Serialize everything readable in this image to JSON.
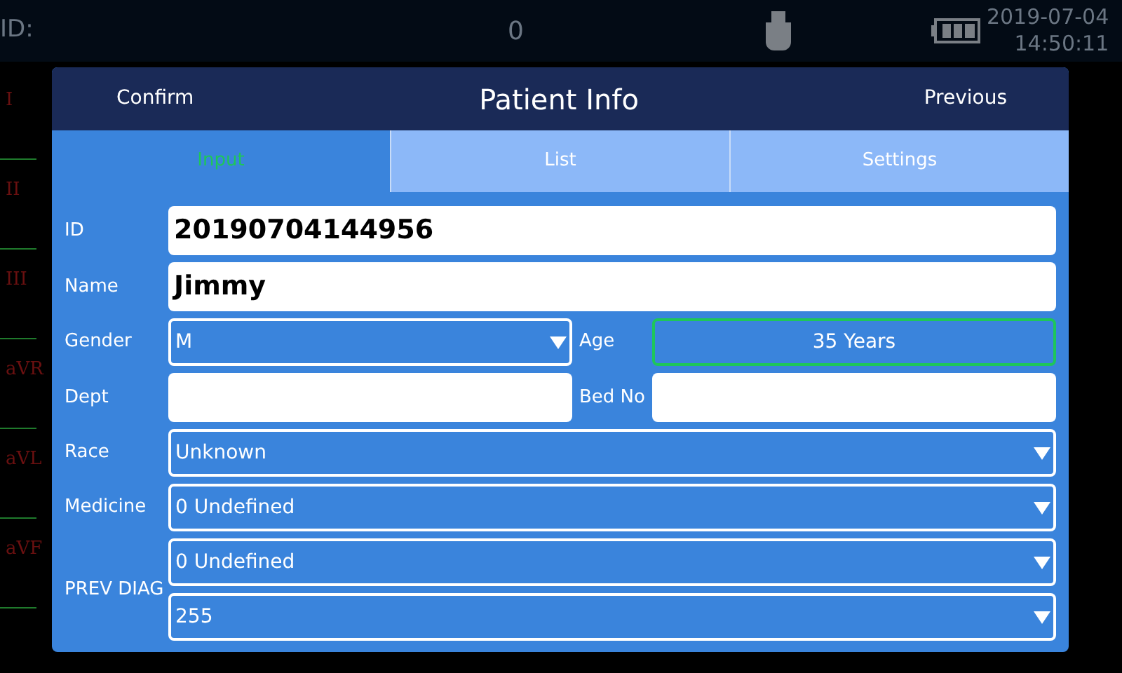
{
  "status_bar": {
    "id_label": "ID:",
    "value": "0",
    "date": "2019-07-04",
    "time": "14:50:11"
  },
  "leads": [
    "I",
    "II",
    "III",
    "aVR",
    "aVL",
    "aVF"
  ],
  "dialog": {
    "title": "Patient Info",
    "confirm": "Confirm",
    "previous": "Previous",
    "tabs": [
      {
        "label": "Input",
        "selected": true
      },
      {
        "label": "List",
        "selected": false
      },
      {
        "label": "Settings",
        "selected": false
      }
    ],
    "rows": [
      {
        "label": "ID",
        "fields": [
          {
            "kind": "text",
            "value": "20190704144956",
            "bold": true
          }
        ]
      },
      {
        "label": "Name",
        "fields": [
          {
            "kind": "text",
            "value": "Jimmy",
            "bold": true
          }
        ]
      },
      {
        "label": "Gender",
        "fields": [
          {
            "kind": "select",
            "value": "M"
          },
          {
            "kind": "readout",
            "label": "Age",
            "value": "35 Years",
            "focused": true
          }
        ]
      },
      {
        "label": "Dept",
        "fields": [
          {
            "kind": "text"
          },
          {
            "kind": "text",
            "label": "Bed No"
          }
        ]
      },
      {
        "label": "Race",
        "fields": [
          {
            "kind": "select",
            "value": "Unknown"
          }
        ]
      },
      {
        "label": "Medicine",
        "fields": [
          {
            "kind": "select",
            "value": "0 Undefined"
          }
        ]
      },
      {
        "label": "PREV DIAG",
        "fields": [
          {
            "kind": "select",
            "value": "0 Undefined"
          },
          {
            "kind": "select",
            "value": "255"
          }
        ]
      }
    ]
  }
}
